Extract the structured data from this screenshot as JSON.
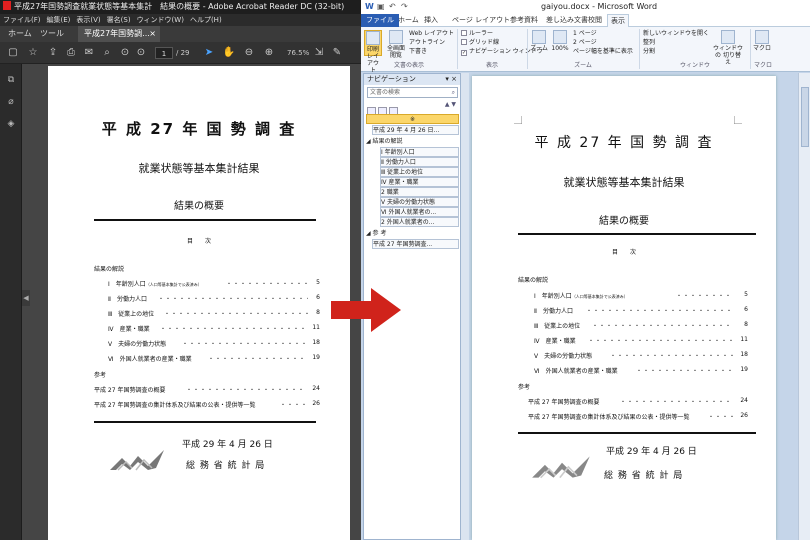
{
  "acrobat": {
    "title": "平成27年国勢調査就業状態等基本集計　結果の概要 - Adobe Acrobat Reader DC (32-bit)",
    "menu": [
      "ファイル(F)",
      "編集(E)",
      "表示(V)",
      "署名(S)",
      "ウィンドウ(W)",
      "ヘルプ(H)"
    ],
    "tabs": {
      "home": "ホーム",
      "tools": "ツール",
      "doc": "平成27年国勢調...",
      "close": "×"
    },
    "page_current": "1",
    "page_total": "/ 29",
    "zoom": "76.5%"
  },
  "doc": {
    "title": "平 成 27 年 国 勢 調 査",
    "subtitle": "就業状態等基本集計結果",
    "heading": "結果の概要",
    "toc_label": "目　　次",
    "section1": "結果の解説",
    "toc": [
      {
        "roman": "Ⅰ",
        "text": "年齢別人口",
        "note": "（人口等基本集計で公表済み）",
        "page": "5"
      },
      {
        "roman": "Ⅱ",
        "text": "労働力人口",
        "note": "",
        "page": "6"
      },
      {
        "roman": "Ⅲ",
        "text": "従業上の地位",
        "note": "",
        "page": "8"
      },
      {
        "roman": "Ⅳ",
        "text": "産業・職業",
        "note": "",
        "page": "11"
      },
      {
        "roman": "Ⅴ",
        "text": "夫婦の労働力状態",
        "note": "",
        "page": "18"
      },
      {
        "roman": "Ⅵ",
        "text": "外国人就業者の産業・職業",
        "note": "",
        "page": "19"
      }
    ],
    "section2": "参考",
    "ref": [
      {
        "text": "平成 27 年国勢調査の概要",
        "page": "24"
      },
      {
        "text": "平成 27 年国勢調査の集計体系及び結果の公表・提供等一覧",
        "page": "26"
      }
    ],
    "date": "平成 29 年 4 月 26 日",
    "org": "総 務 省 統 計 局"
  },
  "word": {
    "title": "gaiyou.docx - Microsoft Word",
    "tabs": [
      "ファイル",
      "ホーム",
      "挿入",
      "ページ レイアウト",
      "参考資料",
      "差し込み文書",
      "校閲",
      "表示"
    ],
    "ribbon": {
      "print_layout": "印刷 レイアウト",
      "full_screen": "全画面 閲覧",
      "web_layout": "Web レイアウト",
      "outline": "アウトライン",
      "draft": "下書き",
      "group_views": "文書の表示",
      "ruler": "ルーラー",
      "gridlines": "グリッド線",
      "nav_pane": "ナビゲーション ウィンドウ",
      "group_show": "表示",
      "zoom": "ズーム",
      "zoom100": "100%",
      "one_page": "1 ページ",
      "two_pages": "2 ページ",
      "page_width": "ページ幅を基準に表示",
      "group_zoom": "ズーム",
      "new_window": "新しいウィンドウを開く",
      "arrange": "整列",
      "split": "分割",
      "switch": "ウィンドウの 切り替え",
      "group_window": "ウィンドウ",
      "macro": "マクロ",
      "group_macro": "マクロ"
    },
    "nav": {
      "header": "ナビゲーション",
      "search": "文書の検索",
      "items": [
        "※",
        "平成 29 年 4 月 26 日...",
        "結果の解説",
        "Ⅰ 年齢別人口",
        "Ⅱ 労働力人口",
        "Ⅲ 従業上の地位",
        "Ⅳ 産業・職業",
        "2 職業",
        "Ⅴ 夫婦の労働力状態",
        "Ⅵ 外国人就業者の...",
        "2 外国人就業者の...",
        "参 考",
        "平成 27 年国勢調査..."
      ]
    }
  }
}
